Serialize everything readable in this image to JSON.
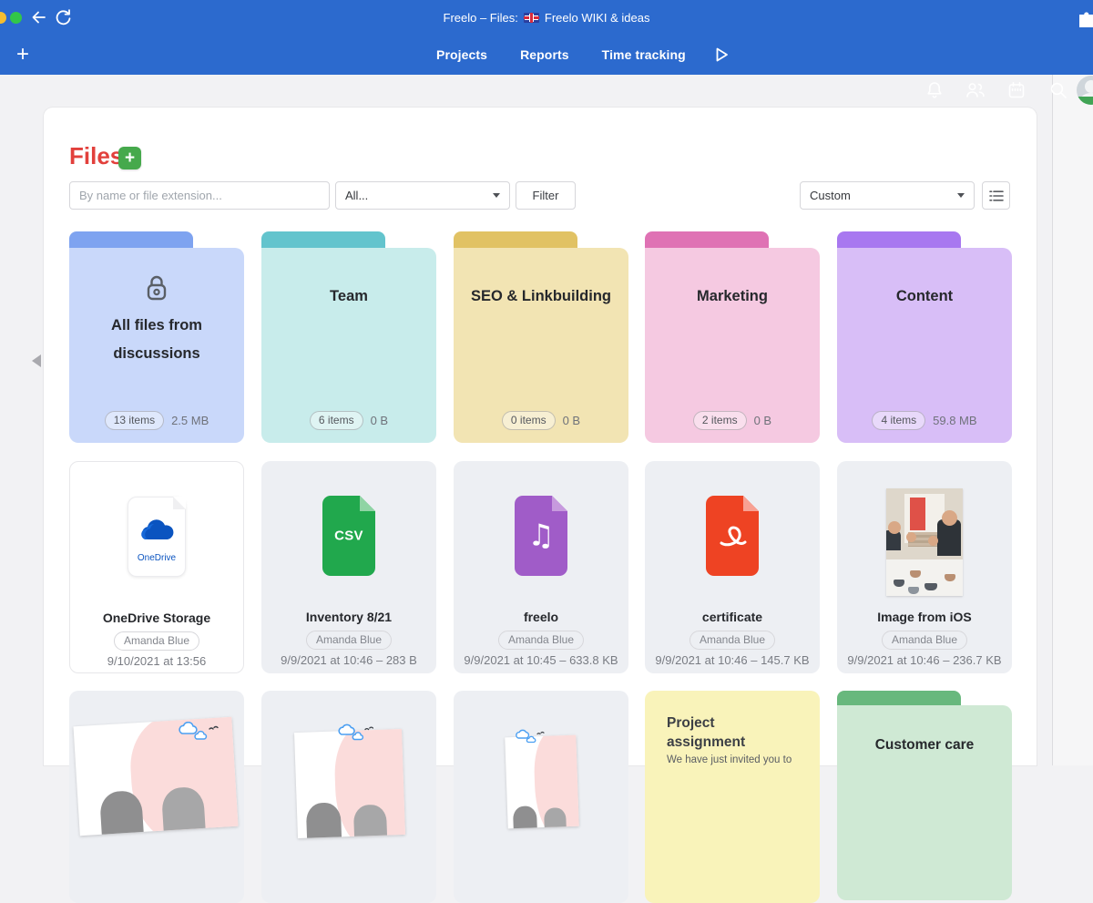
{
  "window": {
    "title_prefix": "Freelo – Files:",
    "title_project": "Freelo WIKI & ideas"
  },
  "navbar": {
    "add_label": "+",
    "links": [
      {
        "label": "Projects"
      },
      {
        "label": "Reports"
      },
      {
        "label": "Time tracking"
      }
    ]
  },
  "breadcrumb": {
    "kebab": "⋮",
    "project": "Freelo WIKI & ideas",
    "separator": "›",
    "current": "Files"
  },
  "page": {
    "title": "Files",
    "add_button": "+"
  },
  "toolbar": {
    "search_placeholder": "By name or file extension...",
    "type_filter_value": "All...",
    "filter_button": "Filter",
    "view_filter_value": "Custom"
  },
  "colors": {
    "topbar_blue": "#2c6ace",
    "title_red": "#e2403c",
    "add_green": "#46a94c"
  },
  "folders": [
    {
      "name": "All files from discussions",
      "badge": "13 items",
      "size": "2.5 MB",
      "colors": {
        "tab": "#7ea3f0",
        "body": "#c9d8fa"
      }
    },
    {
      "name": "Team",
      "badge": "6 items",
      "size": "0 B",
      "colors": {
        "tab": "#63c4cd",
        "body": "#c8eceb"
      }
    },
    {
      "name": "SEO & Linkbuilding",
      "badge": "0 items",
      "size": "0 B",
      "colors": {
        "tab": "#e1c264",
        "body": "#f2e4b3"
      }
    },
    {
      "name": "Marketing",
      "badge": "2 items",
      "size": "0 B",
      "colors": {
        "tab": "#df72b4",
        "body": "#f5c9e1"
      }
    },
    {
      "name": "Content",
      "badge": "4 items",
      "size": "59.8 MB",
      "colors": {
        "tab": "#a878f0",
        "body": "#d8bef7"
      }
    }
  ],
  "files": [
    {
      "name": "OneDrive Storage",
      "author": "Amanda Blue",
      "meta": "9/10/2021 at 13:56",
      "icon_label": "OneDrive"
    },
    {
      "name": "Inventory 8/21",
      "author": "Amanda Blue",
      "meta": "9/9/2021 at 10:46 – 283 B",
      "icon_label": "CSV"
    },
    {
      "name": "freelo",
      "author": "Amanda Blue",
      "meta": "9/9/2021 at 10:45 – 633.8 KB",
      "icon_label": "♫"
    },
    {
      "name": "certificate",
      "author": "Amanda Blue",
      "meta": "9/9/2021 at 10:46 – 145.7 KB"
    },
    {
      "name": "Image from iOS",
      "author": "Amanda Blue",
      "meta": "9/9/2021 at 10:46 – 236.7 KB"
    }
  ],
  "partial_row": {
    "note": {
      "title": "Project assignment",
      "body": "We have just invited you to"
    },
    "folder": {
      "name": "Customer care",
      "colors": {
        "tab": "#68b87d",
        "body": "#cfe9d4"
      }
    }
  }
}
